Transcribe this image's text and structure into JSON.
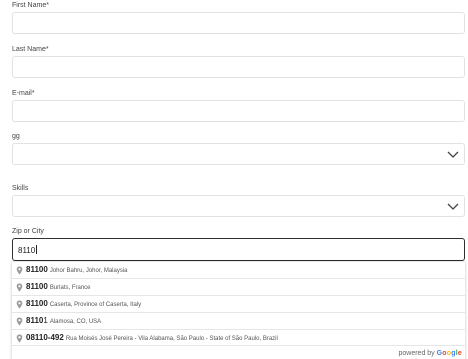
{
  "form": {
    "first_name": {
      "label": "First Name*",
      "value": ""
    },
    "last_name": {
      "label": "Last Name*",
      "value": ""
    },
    "email": {
      "label": "E-mail*",
      "value": ""
    },
    "gg": {
      "label": "gg",
      "value": ""
    },
    "skills": {
      "label": "Skills",
      "value": ""
    },
    "zip": {
      "label": "Zip or City",
      "value": "8110"
    }
  },
  "autocomplete": {
    "items": [
      {
        "match": "81100",
        "rest": "",
        "secondary": "Johor Bahru, Johor, Malaysia"
      },
      {
        "match": "81100",
        "rest": "",
        "secondary": "Burlats, France"
      },
      {
        "match": "81100",
        "rest": "",
        "secondary": "Caserta, Province of Caserta, Italy"
      },
      {
        "match": "8110",
        "rest": "1",
        "secondary": "Alamosa, CO, USA"
      },
      {
        "match": "08110-492",
        "rest": "",
        "secondary": "Rua Moisés José Pereira - Vila Alabama, São Paulo - State of São Paulo, Brazil"
      }
    ],
    "powered_by": "powered by",
    "brand": "Google"
  },
  "colors": {
    "google_blue": "#4285F4",
    "google_red": "#EA4335",
    "google_yellow": "#FBBC05",
    "google_green": "#34A853"
  },
  "icons": {
    "dropdown": "chevron-down-icon",
    "suggestion": "map-pin-icon"
  }
}
